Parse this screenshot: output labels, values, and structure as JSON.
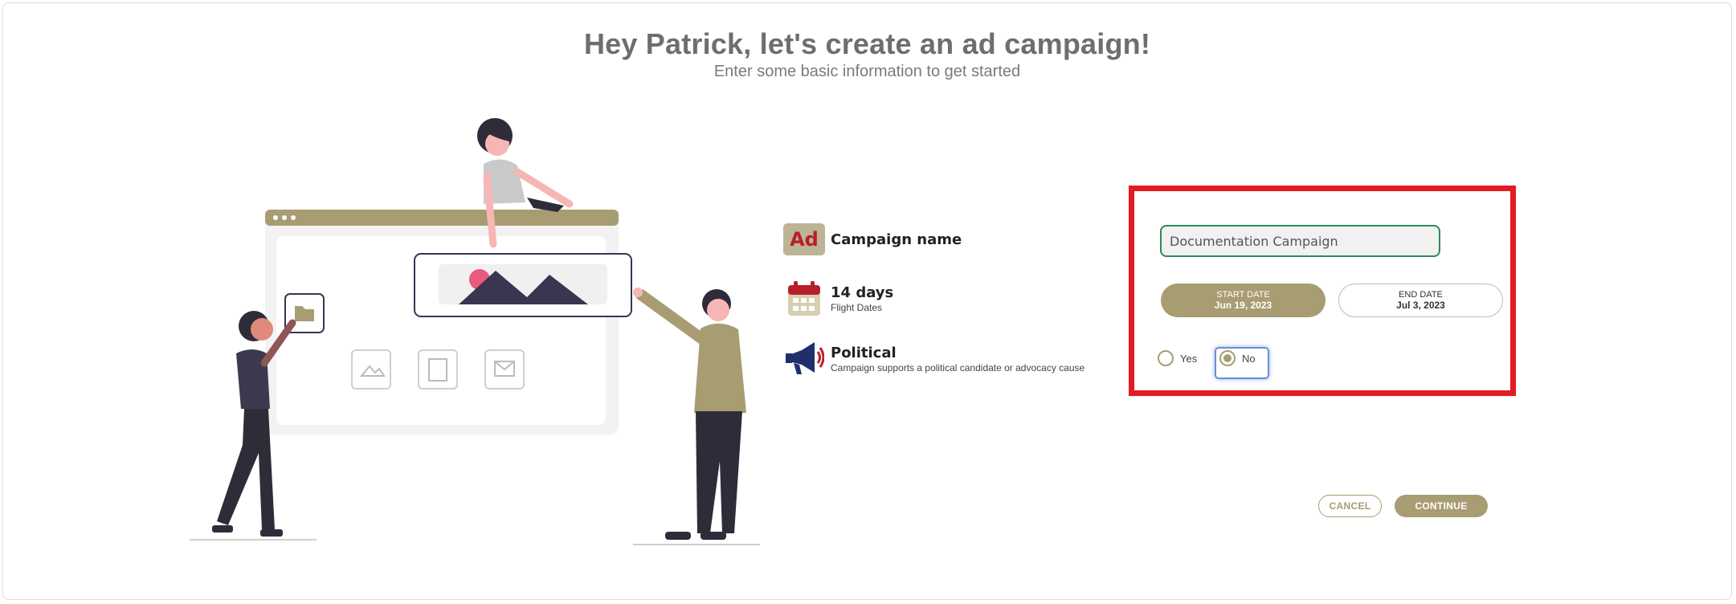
{
  "header": {
    "title": "Hey Patrick, let's create an ad campaign!",
    "subtitle": "Enter some basic information to get started"
  },
  "info": {
    "campaign_name": {
      "icon_text": "Ad",
      "title": "Campaign name"
    },
    "flight_dates": {
      "icon": "calendar-icon",
      "title": "14 days",
      "subtitle": "Flight Dates"
    },
    "political": {
      "icon": "megaphone-icon",
      "title": "Political",
      "subtitle": "Campaign supports a political candidate or advocacy cause"
    }
  },
  "form": {
    "campaign_name_value": "Documentation Campaign",
    "start_date_label": "START DATE",
    "start_date_value": "Jun 19, 2023",
    "end_date_label": "END DATE",
    "end_date_value": "Jul 3, 2023",
    "political_options": [
      {
        "label": "Yes",
        "checked": false
      },
      {
        "label": "No",
        "checked": true
      }
    ]
  },
  "actions": {
    "cancel_label": "CANCEL",
    "continue_label": "CONTINUE"
  },
  "colors": {
    "accent": "#a89c72",
    "highlight": "#e31b23",
    "input_border": "#2e8b57",
    "ad_red": "#b6202a"
  }
}
